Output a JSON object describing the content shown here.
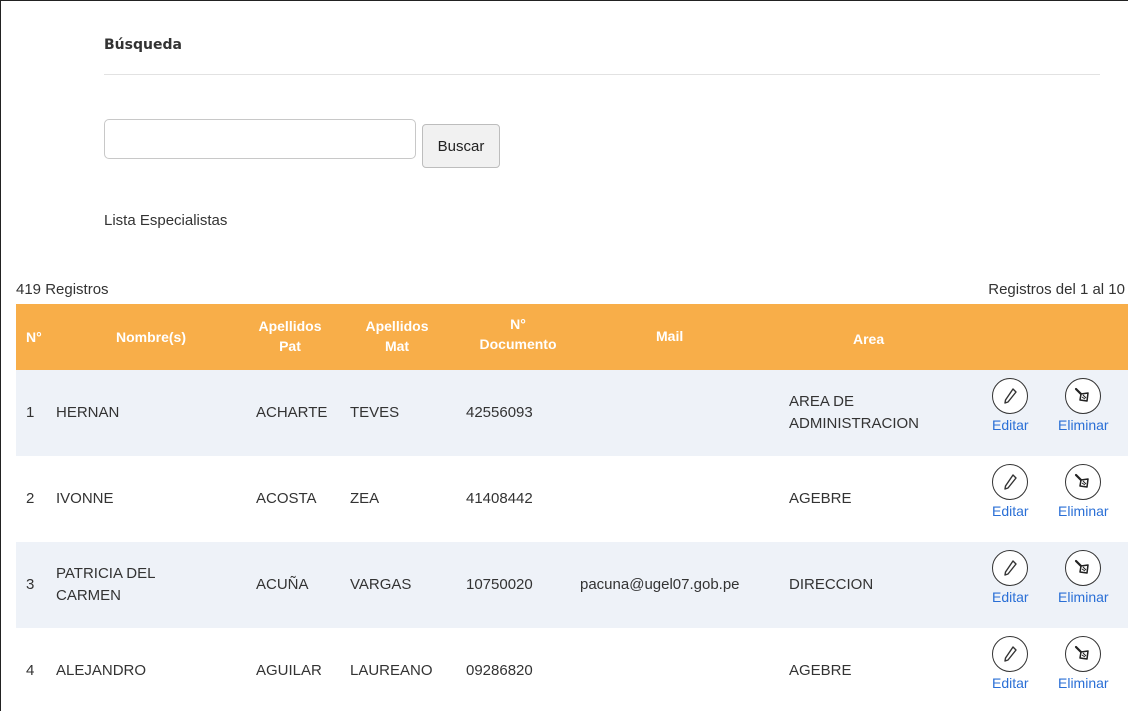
{
  "search": {
    "section_title": "Búsqueda",
    "input_value": "",
    "button_label": "Buscar"
  },
  "list": {
    "title": "Lista Especialistas",
    "count_text": "419  Registros",
    "range_text": "Registros del 1  al 10"
  },
  "table": {
    "headers": {
      "num": "N°",
      "nombre": "Nombre(s)",
      "ap_pat_1": "Apellidos",
      "ap_pat_2": "Pat",
      "ap_mat_1": "Apellidos",
      "ap_mat_2": "Mat",
      "doc_1": "N°",
      "doc_2": "Documento",
      "mail": "Mail",
      "area": "Area"
    },
    "header_color": "#f8ae49",
    "actions": {
      "edit_label": "Editar",
      "delete_label": "Eliminar",
      "edit_icon": "pencil-icon",
      "delete_icon": "broom-icon"
    },
    "rows": [
      {
        "num": "1",
        "nombre_1": "HERNAN",
        "nombre_2": "",
        "ap_pat": "ACHARTE",
        "ap_mat": "TEVES",
        "doc": "42556093",
        "mail": "",
        "area_1": "AREA DE",
        "area_2": "ADMINISTRACION"
      },
      {
        "num": "2",
        "nombre_1": "IVONNE",
        "nombre_2": "",
        "ap_pat": "ACOSTA",
        "ap_mat": "ZEA",
        "doc": "41408442",
        "mail": "",
        "area_1": "AGEBRE",
        "area_2": ""
      },
      {
        "num": "3",
        "nombre_1": "PATRICIA DEL",
        "nombre_2": "CARMEN",
        "ap_pat": "ACUÑA",
        "ap_mat": "VARGAS",
        "doc": "10750020",
        "mail": "pacuna@ugel07.gob.pe",
        "area_1": "DIRECCION",
        "area_2": ""
      },
      {
        "num": "4",
        "nombre_1": "ALEJANDRO",
        "nombre_2": "",
        "ap_pat": "AGUILAR",
        "ap_mat": "LAUREANO",
        "doc": "09286820",
        "mail": "",
        "area_1": "AGEBRE",
        "area_2": ""
      }
    ]
  }
}
